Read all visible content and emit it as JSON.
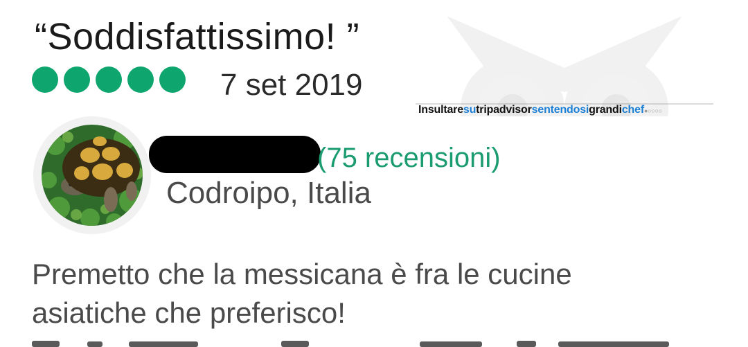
{
  "review": {
    "title": "“Soddisfattissimo! ”",
    "rating": 5,
    "date": "7 set 2019",
    "reviewer": {
      "review_count": "(75 recensioni)",
      "location": "Codroipo, Italia",
      "avatar": "tortoise-photo"
    },
    "text_lines": [
      "Premetto che la messicana è fra le cucine",
      "asiatiche che preferisco!"
    ]
  },
  "watermark": {
    "p1": "Insultare",
    "p2": "su",
    "p3": "tripadvisor",
    "p4": "sentendosi",
    "p5": "grandi",
    "p6": "chef",
    "p7": "●○○○○"
  },
  "colors": {
    "rating_green": "#0ea66e",
    "reviews_green": "#1a9b70",
    "watermark_blue": "#1b7fd6"
  }
}
